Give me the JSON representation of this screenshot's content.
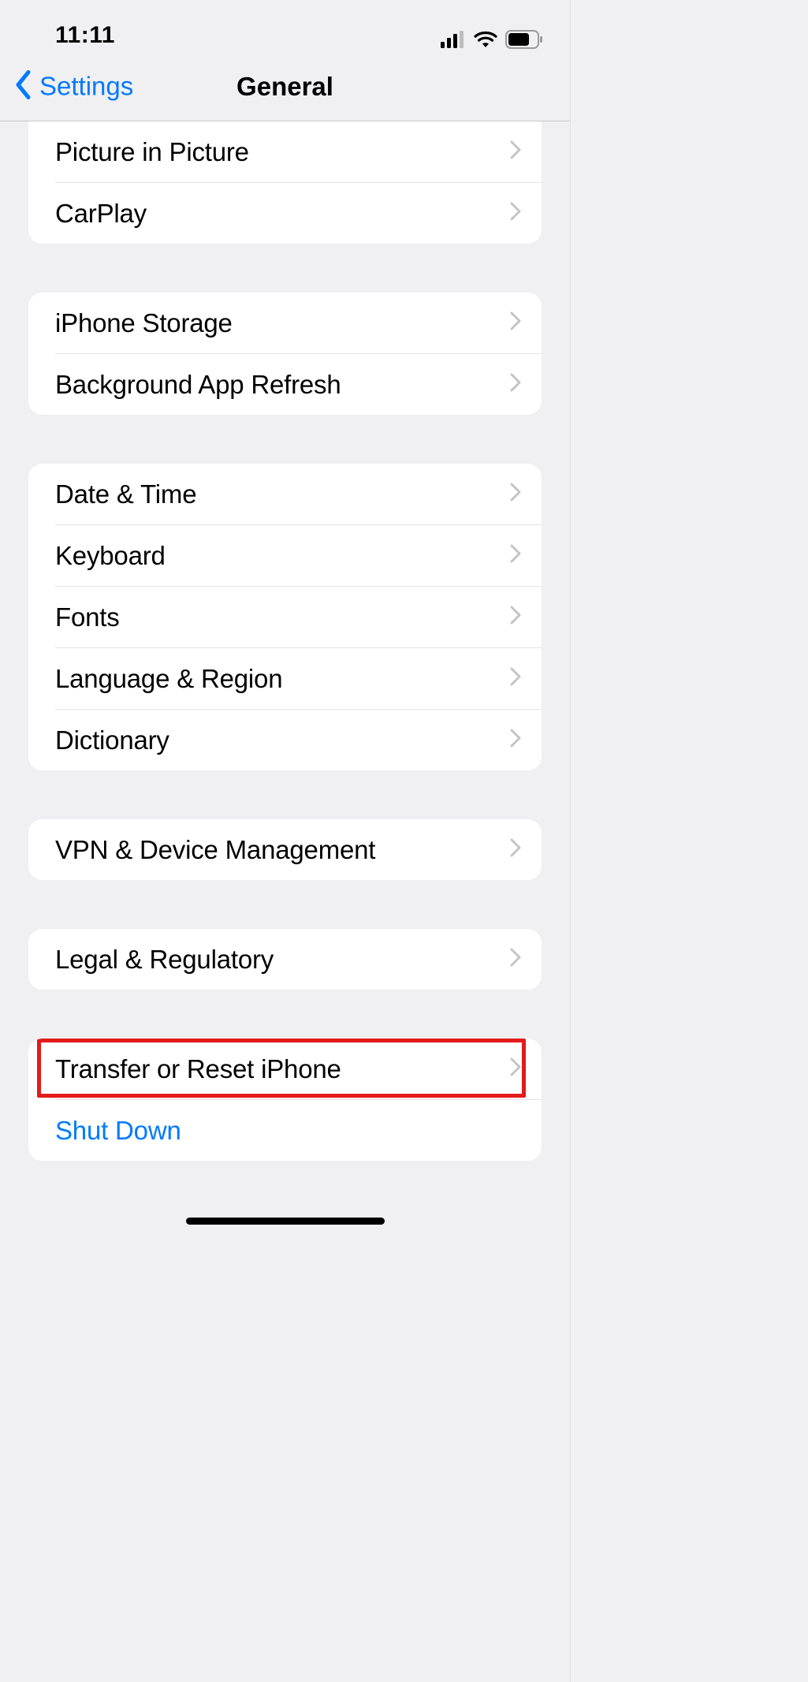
{
  "status": {
    "time": "11:11"
  },
  "nav": {
    "back": "Settings",
    "title": "General"
  },
  "groups": {
    "g0": [
      "Picture in Picture",
      "CarPlay"
    ],
    "g1": [
      "iPhone Storage",
      "Background App Refresh"
    ],
    "g2": [
      "Date & Time",
      "Keyboard",
      "Fonts",
      "Language & Region",
      "Dictionary"
    ],
    "g3": [
      "VPN & Device Management"
    ],
    "g4": [
      "Legal & Regulatory"
    ],
    "g5": {
      "transfer": "Transfer or Reset iPhone",
      "shutdown": "Shut Down"
    }
  },
  "highlighted": "transfer-or-reset-iphone"
}
